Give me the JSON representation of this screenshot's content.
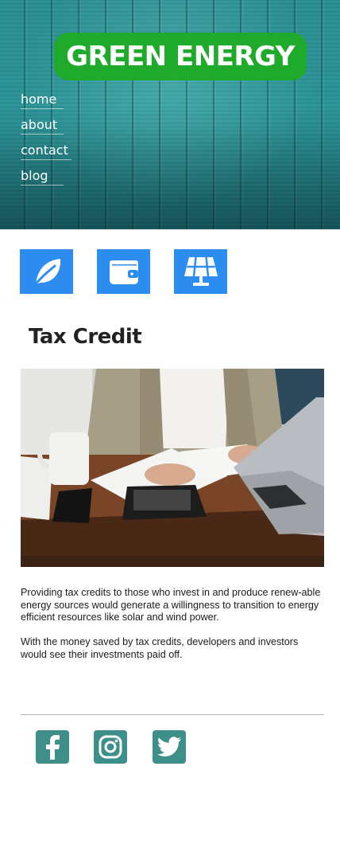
{
  "brand": {
    "title": "GREEN ENERGY"
  },
  "nav": {
    "items": [
      {
        "label": "home"
      },
      {
        "label": "about"
      },
      {
        "label": "contact"
      },
      {
        "label": "blog"
      }
    ]
  },
  "features": [
    {
      "icon": "leaf-icon"
    },
    {
      "icon": "wallet-icon"
    },
    {
      "icon": "solar-panel-icon"
    }
  ],
  "article": {
    "title": "Tax Credit",
    "image": "person-using-calculator-with-laptop-photo",
    "paragraphs": [
      "Providing tax credits to those who invest in and produce renew-able energy sources would generate a willingness to transition to energy efficient resources like solar and wind power.",
      "With the money saved by tax credits, developers and investors would see their investments paid off."
    ]
  },
  "social": [
    {
      "icon": "facebook-icon"
    },
    {
      "icon": "instagram-icon"
    },
    {
      "icon": "twitter-icon"
    }
  ],
  "colors": {
    "brand_green": "#1faa2b",
    "feature_blue": "#2d8cf0",
    "social_teal": "#3e8f8a",
    "hero_teal": "#2a9497"
  }
}
